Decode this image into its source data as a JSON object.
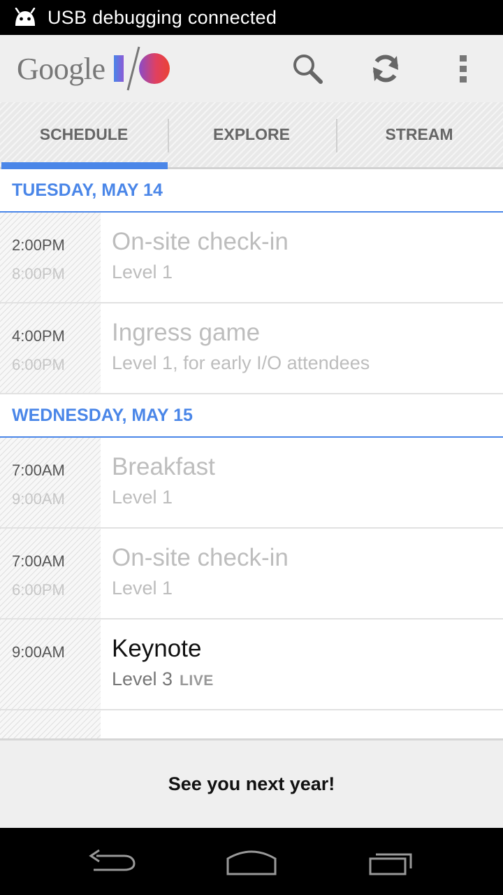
{
  "status_bar": {
    "text": "USB debugging connected",
    "icon": "android-debug-icon"
  },
  "action_bar": {
    "logo_text": "Google",
    "logo_mark": "I/O",
    "icons": [
      "search-icon",
      "refresh-icon",
      "overflow-menu-icon"
    ]
  },
  "tabs": [
    {
      "label": "SCHEDULE",
      "selected": true
    },
    {
      "label": "EXPLORE",
      "selected": false
    },
    {
      "label": "STREAM",
      "selected": false
    }
  ],
  "schedule": {
    "days": [
      {
        "label": "TUESDAY, MAY 14",
        "items": [
          {
            "start": "2:00PM",
            "end": "8:00PM",
            "title": "On-site check-in",
            "location": "Level 1"
          },
          {
            "start": "4:00PM",
            "end": "6:00PM",
            "title": "Ingress game",
            "location": "Level 1, for early I/O attendees"
          }
        ]
      },
      {
        "label": "WEDNESDAY, MAY 15",
        "items": [
          {
            "start": "7:00AM",
            "end": "9:00AM",
            "title": "Breakfast",
            "location": "Level 1"
          },
          {
            "start": "7:00AM",
            "end": "6:00PM",
            "title": "On-site check-in",
            "location": "Level 1"
          },
          {
            "start": "9:00AM",
            "title": "Keynote",
            "location": "Level 3",
            "badge": "LIVE"
          }
        ]
      }
    ]
  },
  "footer": {
    "message": "See you next year!"
  },
  "nav_bar": {
    "icons": [
      "back-icon",
      "home-icon",
      "recents-icon"
    ]
  },
  "colors": {
    "accent": "#4a86e8",
    "partial_item": "#3a9a3a"
  }
}
